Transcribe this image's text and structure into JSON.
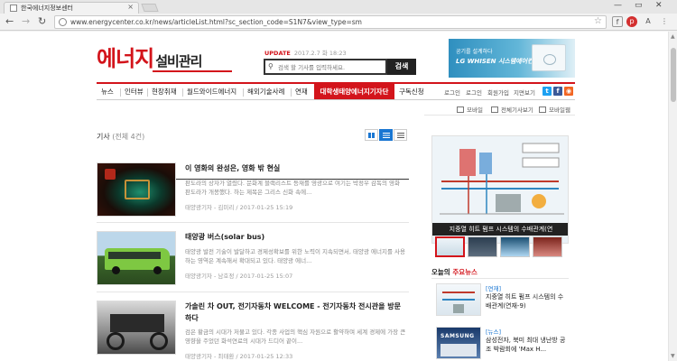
{
  "browser": {
    "tab_title": "한국에너지정보센터",
    "url": "www.energycenter.co.kr/news/articleList.html?sc_section_code=S1N7&view_type=sm",
    "window_controls": [
      "—",
      "▭",
      "✕"
    ]
  },
  "site": {
    "logo_main": "에너지",
    "logo_sub": "설비관리",
    "brand_color": "#d3141b"
  },
  "header": {
    "update_label": "UPDATE",
    "update_time": "2017.2.7 화 18:23",
    "search_placeholder": "검색 할 기사를 입력하세요.",
    "search_button": "검색"
  },
  "ad_banner": {
    "line1": "공기를 설계하다",
    "line2": "LG WHISEN 시스템에어컨"
  },
  "gnb": {
    "menu": [
      "뉴스",
      "인터뷰",
      "현장취재",
      "월드와이드에너지",
      "해외기술사례",
      "연재"
    ],
    "highlight": "대학생태양에너지기자단",
    "last": "구독신청",
    "util": [
      "회원가입",
      "로그인",
      "회원가입",
      "지면보기"
    ]
  },
  "gnb_util_actual": [
    "로그인",
    "로그인",
    "회원가입",
    "지면보기"
  ],
  "sub_util": [
    "모바일",
    "전체기사보기",
    "모바일웹"
  ],
  "list": {
    "title": "기사",
    "count": "(전체 4건)"
  },
  "articles": [
    {
      "title": "이 영화의 완성은, 영화 밖 현실",
      "summary": "판도라의 상자가 열렸다. 문화계 블랙리스트 등재를 영광으로 여기는 박정우 감독의 영화 판도라가 개봉했다. 하는 제목은 그리스 신화 속에...",
      "author": "태양광기자 - 김미리",
      "date": "2017-01-25 15:19"
    },
    {
      "title": "태양광 버스(solar bus)",
      "summary": "태양광 발전 기술이 발달하고 경제성확보를 위한 노력이 지속되면서, 태양광 에너지를 사용하는 영역은 계속해서 확대되고 있다. 태양광 에너...",
      "author": "태양광기자 - 남호정",
      "date": "2017-01-25 15:07"
    },
    {
      "title": "가솔린 차 OUT, 전기자동차 WELCOME - 전기자동차 전시관을 방문하다",
      "summary": "검은 황금의 시대가 저물고 있다. 각종 사업의 핵심 자원으로 활약하며 세계 경제에 가장 큰 영향을 주었던 화석연료의 시대가 드디어 끝이...",
      "author": "태양광기자 - 최태환",
      "date": "2017-01-25 12:33"
    }
  ],
  "sidebar": {
    "slide_caption": "지중열 히트 펌프 시스템의 수배관계(연",
    "today_prefix": "오늘의",
    "today_label": "주요뉴스",
    "items": [
      {
        "category": "[연재]",
        "title": "지중열 히트 펌프 시스템의 수배관계(연재-9)"
      },
      {
        "category": "[뉴스]",
        "title": "삼성전자, 북미 최대 냉난방 공조 박람회에 'Max H..."
      }
    ]
  },
  "colors": {
    "accent": "#d3141b",
    "view_active": "#1976d2",
    "sns_twitter": "#1da1f2",
    "sns_facebook": "#3b5998",
    "sns_rss": "#f26522"
  },
  "icons": [
    "back-icon",
    "forward-icon",
    "reload-icon",
    "search-icon",
    "grid-view-icon",
    "list-view-icon",
    "text-view-icon"
  ]
}
